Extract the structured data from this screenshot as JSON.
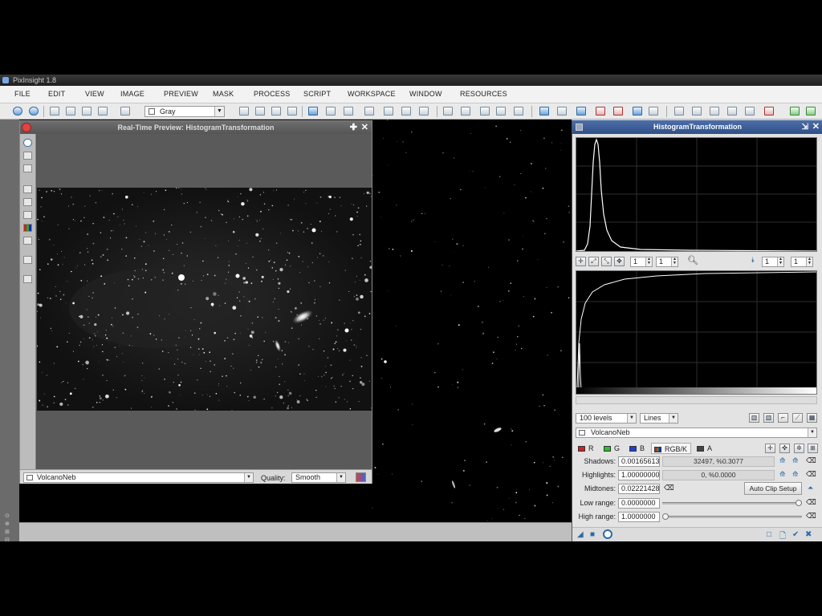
{
  "app": {
    "title": "PixInsight 1.8"
  },
  "menu": [
    "FILE",
    "EDIT",
    "VIEW",
    "IMAGE",
    "PREVIEW",
    "MASK",
    "PROCESS",
    "SCRIPT",
    "WORKSPACE",
    "WINDOW",
    "RESOURCES"
  ],
  "toolbar": {
    "channel_select": "Gray"
  },
  "preview_window": {
    "title": "Real-Time Preview: HistogramTransformation",
    "view_select": "VolcanoNeb",
    "quality_label": "Quality:",
    "quality_value": "Smooth"
  },
  "histogram": {
    "title": "HistogramTransformation",
    "zoom_h": "1",
    "zoom_v": "1",
    "zoom2_h": "1",
    "zoom2_v": "1",
    "levels_select": "100 levels",
    "plot_mode_select": "Lines",
    "view_select": "VolcanoNeb",
    "channels": [
      {
        "label": "R",
        "color": "#d02020"
      },
      {
        "label": "G",
        "color": "#2ac02a"
      },
      {
        "label": "B",
        "color": "#2040d0"
      },
      {
        "label": "RGB/K",
        "color": "#2040d0"
      },
      {
        "label": "A",
        "color": "#444444"
      }
    ],
    "shadows_label": "Shadows:",
    "shadows_value": "0.00165613",
    "shadows_stats": "32497, %0.3077",
    "highlights_label": "Highlights:",
    "highlights_value": "1.00000000",
    "highlights_stats": "0, %0.0000",
    "midtones_label": "Midtones:",
    "midtones_value": "0.02221428",
    "auto_clip_label": "Auto Clip Setup",
    "low_range_label": "Low range:",
    "low_range_value": "0.0000000",
    "high_range_label": "High range:",
    "high_range_value": "1.0000000"
  }
}
